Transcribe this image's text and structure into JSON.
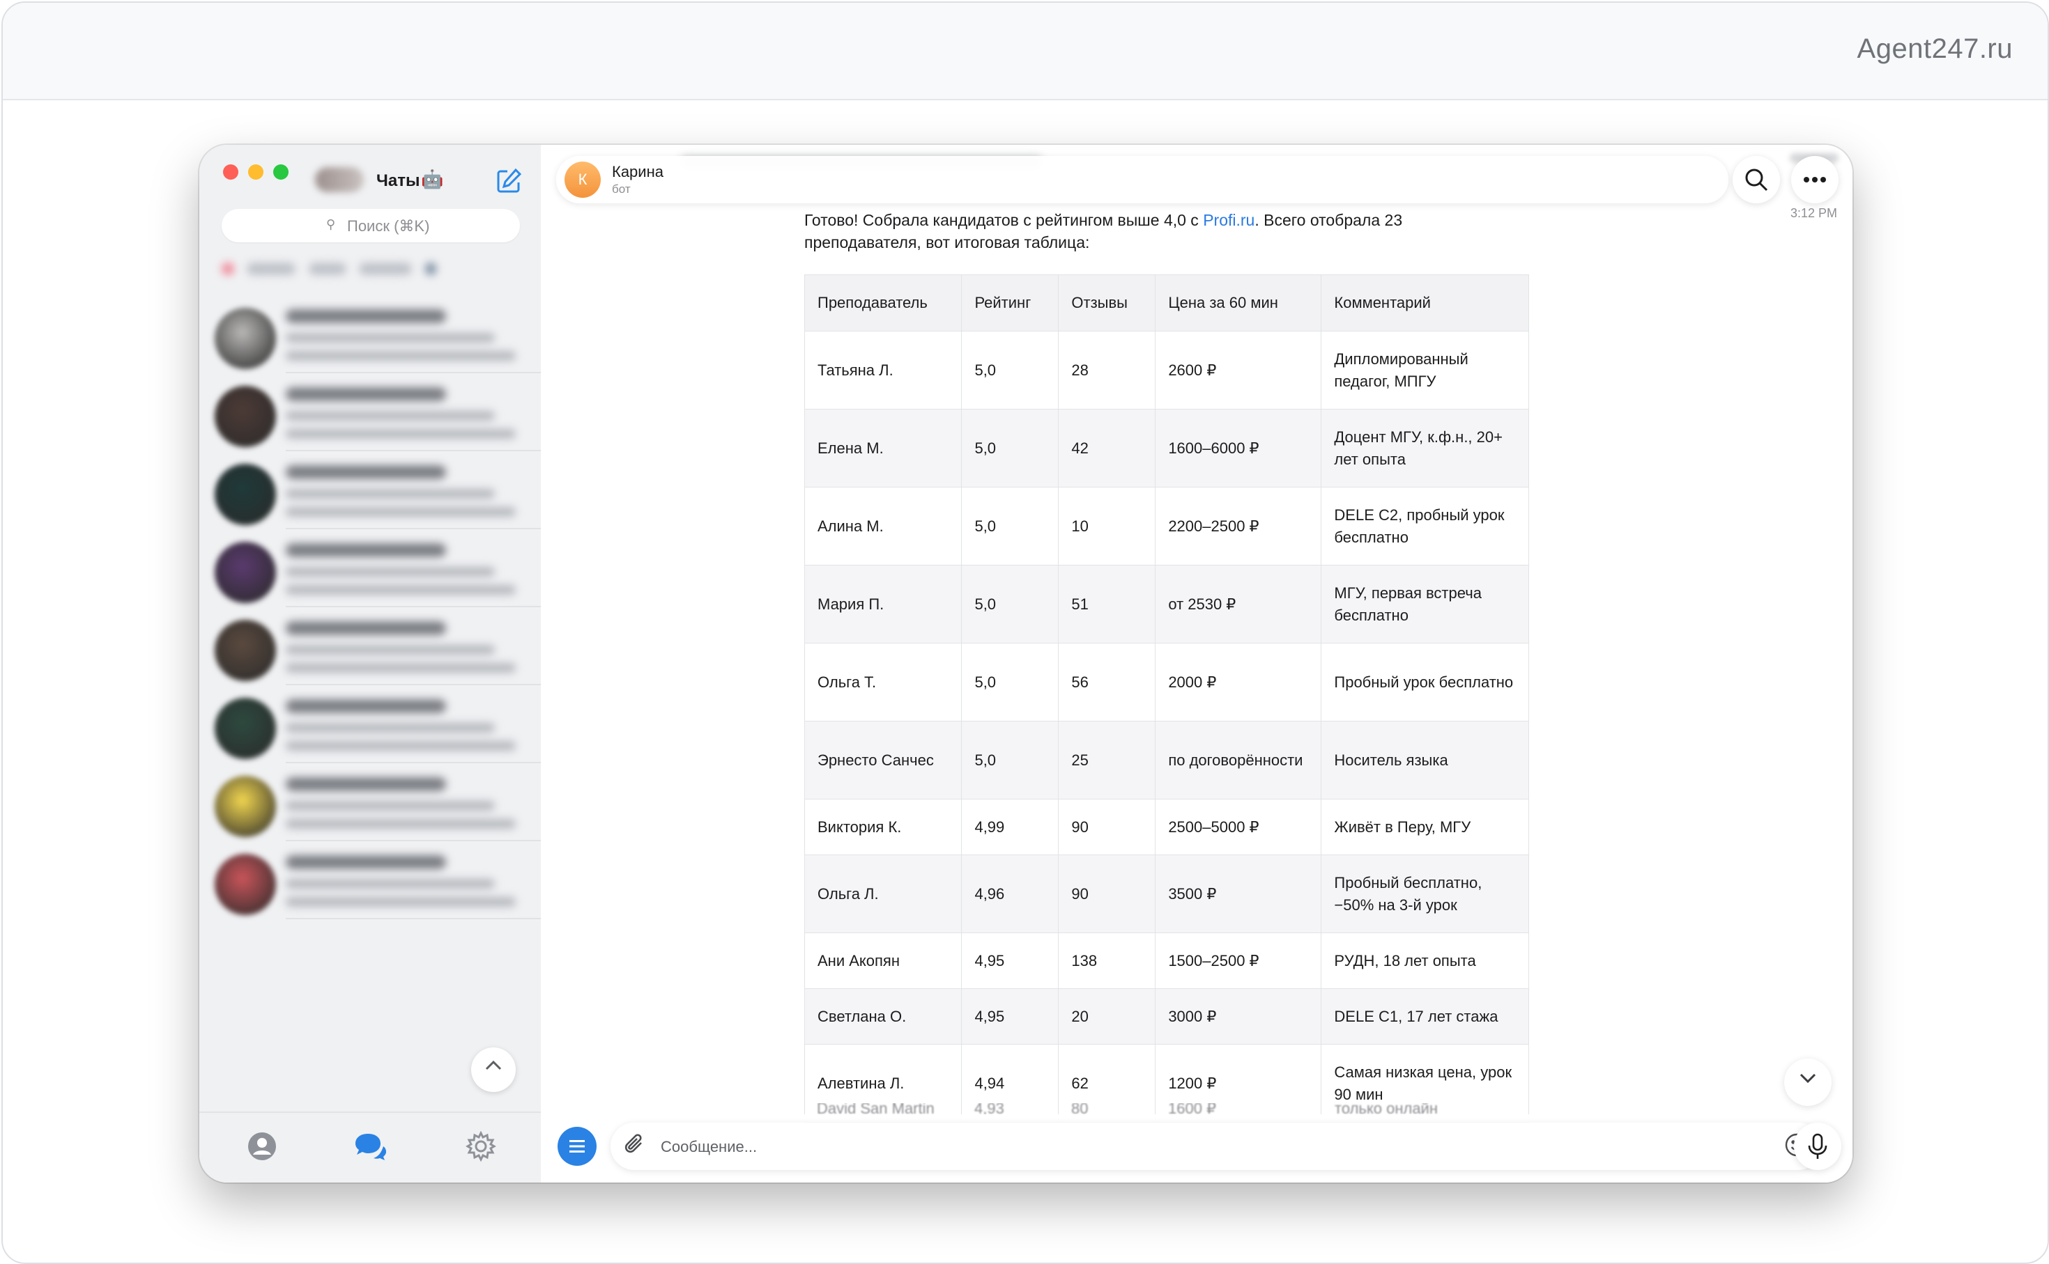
{
  "brand": "Agent247.ru",
  "sidebar": {
    "title": "Чаты",
    "title_emoji": "🤖",
    "search_placeholder": "Поиск (⌘K)",
    "chat_avatars": [
      "#b9b8b6",
      "#4d3b36",
      "#1f3a3a",
      "#5a3a6e",
      "#5b4a3f",
      "#2d4a3f",
      "#f2d64f",
      "#c9555a"
    ]
  },
  "chat": {
    "contact_name": "Карина",
    "contact_initial": "К",
    "contact_status": "бот",
    "message_time": "3:12 PM",
    "message_before_link": "Готово! Собрала кандидатов с рейтингом выше 4,0 с ",
    "message_link": "Profi.ru",
    "message_after_link": ". Всего отобрала 23 преподавателя, вот итоговая таблица:",
    "table": {
      "headers": [
        "Преподаватель",
        "Рейтинг",
        "Отзывы",
        "Цена за 60 мин",
        "Комментарий"
      ],
      "rows": [
        [
          "Татьяна Л.",
          "5,0",
          "28",
          "2600 ₽",
          "Дипломированный педагог, МПГУ"
        ],
        [
          "Елена М.",
          "5,0",
          "42",
          "1600–6000 ₽",
          "Доцент МГУ, к.ф.н., 20+ лет опыта"
        ],
        [
          "Алина М.",
          "5,0",
          "10",
          "2200–2500 ₽",
          "DELE C2, пробный урок бесплатно"
        ],
        [
          "Мария П.",
          "5,0",
          "51",
          "от 2530 ₽",
          "МГУ, первая встреча бесплатно"
        ],
        [
          "Ольга Т.",
          "5,0",
          "56",
          "2000 ₽",
          "Пробный урок бесплатно"
        ],
        [
          "Эрнесто Санчес",
          "5,0",
          "25",
          "по договорённости",
          "Носитель языка"
        ],
        [
          "Виктория К.",
          "4,99",
          "90",
          "2500–5000 ₽",
          "Живёт в Перу, МГУ"
        ],
        [
          "Ольга Л.",
          "4,96",
          "90",
          "3500 ₽",
          "Пробный бесплатно, −50% на 3-й урок"
        ],
        [
          "Ани Акопян",
          "4,95",
          "138",
          "1500–2500 ₽",
          "РУДН, 18 лет опыта"
        ],
        [
          "Светлана О.",
          "4,95",
          "20",
          "3000 ₽",
          "DELE C1, 17 лет стажа"
        ],
        [
          "Алевтина Л.",
          "4,94",
          "62",
          "1200 ₽",
          "Самая низкая цена, урок 90 мин"
        ]
      ],
      "partial_row": [
        "David San Martin",
        "4,93",
        "80",
        "1600 ₽",
        "только онлайн"
      ]
    },
    "composer_placeholder": "Сообщение..."
  },
  "colors": {
    "accent": "#2a82e4",
    "link": "#2a7ae2",
    "avatar_orange": "#f4933b"
  }
}
